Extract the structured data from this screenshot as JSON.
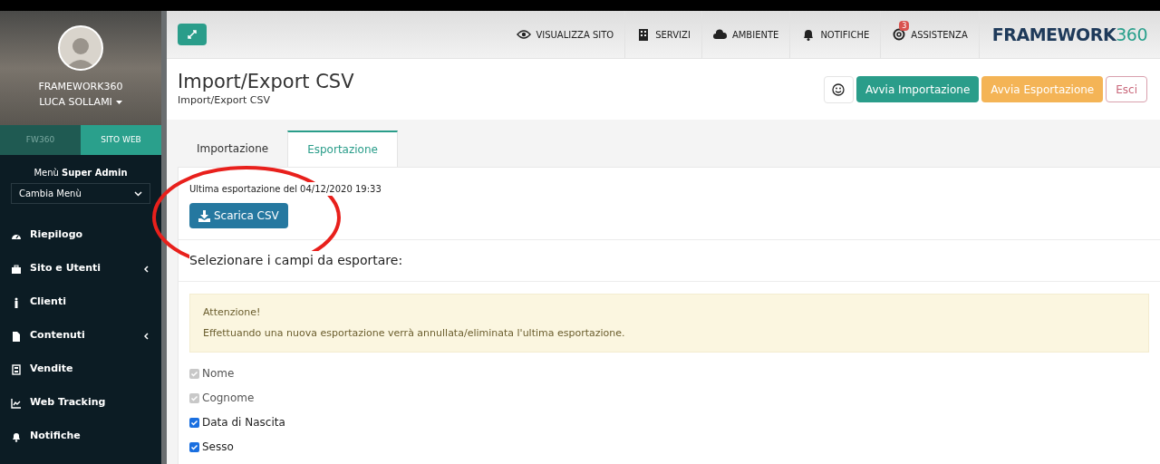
{
  "sidebar": {
    "profile": {
      "company": "FRAMEWORK360",
      "user": "LUCA SOLLAMI"
    },
    "tabs": [
      {
        "label": "FW360",
        "selected": false
      },
      {
        "label": "SITO WEB",
        "selected": true
      }
    ],
    "menu_label": "Menù **Super Admin**",
    "menu_select": {
      "value": "Cambia Menù"
    },
    "items": [
      {
        "kind": "dashboard",
        "label": "Riepilogo",
        "has_submenu": false
      },
      {
        "kind": "briefcase",
        "label": "Sito e Utenti",
        "has_submenu": true
      },
      {
        "kind": "person",
        "label": "Clienti",
        "has_submenu": false
      },
      {
        "kind": "file",
        "label": "Contenuti",
        "has_submenu": true
      },
      {
        "kind": "calculator",
        "label": "Vendite",
        "has_submenu": false
      },
      {
        "kind": "chart",
        "label": "Web Tracking",
        "has_submenu": false
      },
      {
        "kind": "bell",
        "label": "Notifiche",
        "has_submenu": false
      }
    ]
  },
  "topbar": {
    "nav": [
      {
        "kind": "eye",
        "label": "VISUALIZZA SITO"
      },
      {
        "kind": "building",
        "label": "SERVIZI"
      },
      {
        "kind": "cloud",
        "label": "AMBIENTE"
      },
      {
        "kind": "bell",
        "label": "NOTIFICHE"
      },
      {
        "kind": "lifebuoy",
        "label": "ASSISTENZA",
        "badge": "3"
      }
    ],
    "logo": {
      "part_1": "FRAMEWORK",
      "part_2": "360"
    }
  },
  "page": {
    "title": "Import/Export CSV",
    "breadcrumb": "Import/Export CSV",
    "actions": [
      {
        "kind": "icon"
      },
      {
        "kind": "primary",
        "label": "Avvia Importazione"
      },
      {
        "kind": "warning",
        "label": "Avvia Esportazione"
      },
      {
        "kind": "outline",
        "label": "Esci"
      }
    ]
  },
  "tabs": [
    {
      "label": "Importazione",
      "selected": false
    },
    {
      "label": "Esportazione",
      "selected": true
    }
  ],
  "export": {
    "last_export": "Ultima esportazione del 04/12/2020 19:33",
    "download_button": "Scarica CSV",
    "fields_heading": "Selezionare i campi da esportare:",
    "alert": {
      "title": "Attenzione!",
      "message": "Effettuando una nuova esportazione verrà annullata/eliminata l'ultima esportazione."
    },
    "fields": [
      {
        "label": "Nome",
        "checked": true,
        "disabled": true
      },
      {
        "label": "Cognome",
        "checked": true,
        "disabled": true
      },
      {
        "label": "Data di Nascita",
        "checked": true,
        "disabled": false
      },
      {
        "label": "Sesso",
        "checked": true,
        "disabled": false
      }
    ]
  }
}
